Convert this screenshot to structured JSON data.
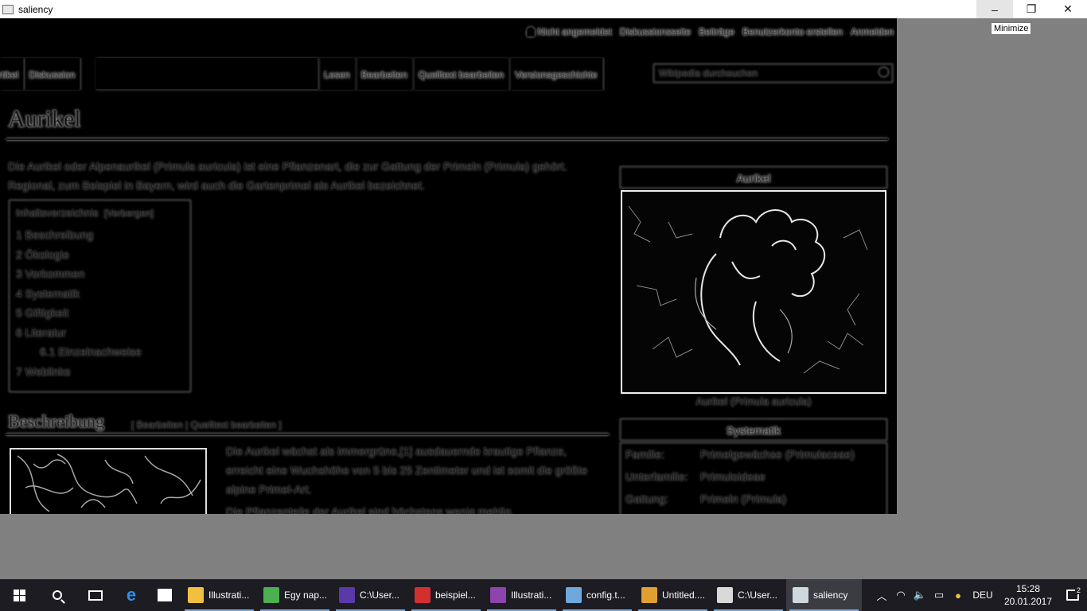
{
  "window": {
    "title": "saliency",
    "controls": {
      "minimize": "–",
      "maximize": "❐",
      "close": "✕"
    },
    "tooltip": "Minimize"
  },
  "page": {
    "toplinks": [
      "Nicht angemeldet",
      "Diskussionsseite",
      "Beiträge",
      "Benutzerkonto erstellen",
      "Anmelden"
    ],
    "tabs_left": [
      "Artikel",
      "Diskussion"
    ],
    "tabs_right": [
      "Lesen",
      "Bearbeiten",
      "Quelltext bearbeiten",
      "Versionsgeschichte"
    ],
    "search_placeholder": "Wikipedia durchsuchen",
    "title": "Aurikel",
    "intro": "Die Aurikel oder Alpenaurikel (Primula auricula) ist eine Pflanzenart, die zur Gattung der Primeln (Primula) gehört. Regional, zum Beispiel in Bayern, wird auch die Gartenprimel als Aurikel bezeichnet.",
    "toc": {
      "heading": "Inhaltsverzeichnis",
      "hide": "[Verbergen]",
      "items": [
        {
          "label": "1 Beschreibung"
        },
        {
          "label": "2 Ökologie"
        },
        {
          "label": "3 Vorkommen"
        },
        {
          "label": "4 Systematik"
        },
        {
          "label": "5 Giftigkeit"
        },
        {
          "label": "6 Literatur"
        },
        {
          "label": "6.1 Einzelnachweise",
          "sub": true
        },
        {
          "label": "7 Weblinks"
        }
      ]
    },
    "section_heading": "Beschreibung",
    "section_edit": "[ Bearbeiten | Quelltext bearbeiten ]",
    "section_text": "Die Aurikel wächst als immergrüne,[1] ausdauernde krautige Pflanze, erreicht eine Wuchshöhe von 5 bis 25 Zentimeter und ist somit die größte alpine Primel-Art.",
    "section_text2": "Die Pflanzenteile der Aurikel sind höchstens wenig mehlig.",
    "infobox": {
      "title": "Aurikel",
      "caption": "Aurikel (Primula auricula)",
      "systematik": "Systematik",
      "rows": [
        {
          "k": "Familie:",
          "v": "Primelgewächse (Primulaceae)"
        },
        {
          "k": "Unterfamilie:",
          "v": "Primuloideae"
        },
        {
          "k": "Gattung:",
          "v": "Primeln (Primula)"
        }
      ]
    }
  },
  "taskbar": {
    "apps": [
      {
        "label": "Illustrati...",
        "icon": "folder-icon",
        "color": "#f0c040"
      },
      {
        "label": "Egy nap...",
        "icon": "chrome-icon",
        "color": "#4caf50"
      },
      {
        "label": "C:\\User...",
        "icon": "jpx-icon",
        "color": "#5a3aa8"
      },
      {
        "label": "beispiel...",
        "icon": "pdf-icon",
        "color": "#d32f2f"
      },
      {
        "label": "Illustrati...",
        "icon": "visual-studio-icon",
        "color": "#8e44ad"
      },
      {
        "label": "config.t...",
        "icon": "notepad-icon",
        "color": "#6fa8dc"
      },
      {
        "label": "Untitled....",
        "icon": "paint-icon",
        "color": "#e0a030"
      },
      {
        "label": "C:\\User...",
        "icon": "console-icon",
        "color": "#d9d9d9"
      },
      {
        "label": "saliency",
        "icon": "saliency-app-icon",
        "color": "#cfd8dc",
        "active": true
      }
    ],
    "language": "DEU",
    "time": "15:28",
    "date": "20.01.2017",
    "notifications": "2"
  }
}
